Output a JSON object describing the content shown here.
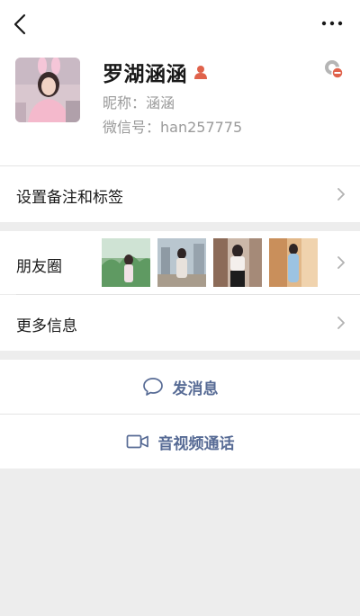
{
  "header": {
    "back_icon": "chevron-left-icon",
    "more_icon": "more-dots-icon"
  },
  "profile": {
    "name": "罗湖涵涵",
    "nickname": "昵称：涵涵",
    "wechat_id": "微信号：han257775",
    "gender_icon": "person-badge-icon",
    "status_icon": "status-minus-icon"
  },
  "rows": {
    "remark_label": "设置备注和标签",
    "moments_label": "朋友圈",
    "more_info_label": "更多信息"
  },
  "actions": {
    "message_label": "发消息",
    "video_call_label": "音视频通话"
  },
  "colors": {
    "accent": "#576b95",
    "gender": "#e0624b",
    "background": "#ededed",
    "secondary_text": "#9a9a9a"
  }
}
